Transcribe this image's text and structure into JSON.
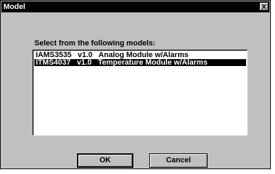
{
  "window": {
    "title": "Model",
    "close_icon": "close-icon"
  },
  "dialog": {
    "prompt": "Select from the following models:",
    "models": [
      "IAMS3535   v1.0   Analog Module w/Alarms",
      "ITMS4037   v1.0   Temperature Module w/Alarms"
    ],
    "selected_index": 1
  },
  "buttons": {
    "ok_label": "OK",
    "cancel_label": "Cancel"
  }
}
